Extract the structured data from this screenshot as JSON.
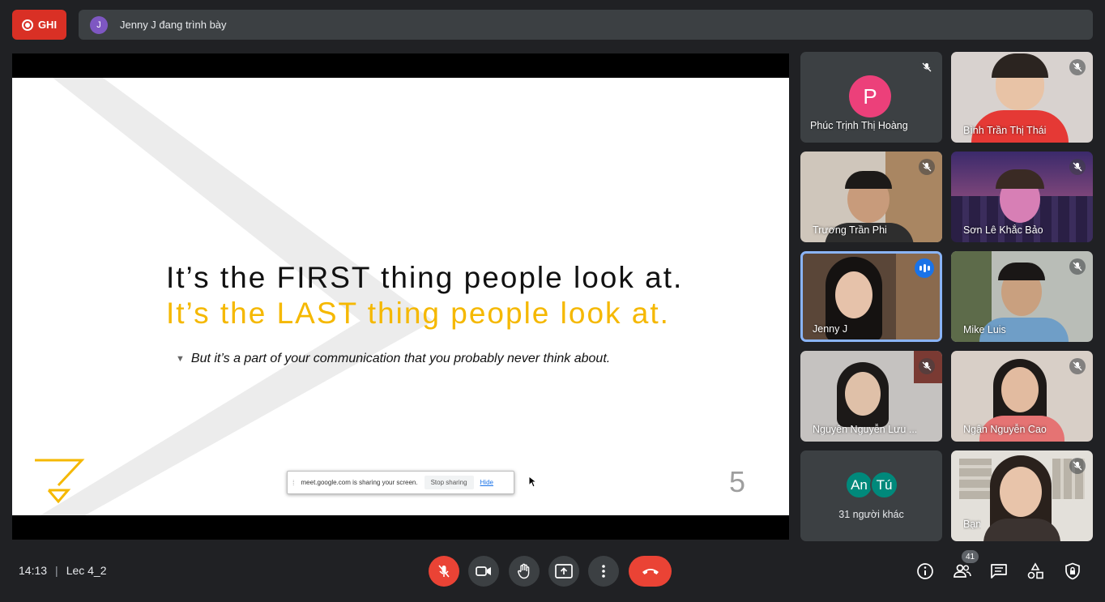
{
  "top": {
    "record_label": "GHI",
    "presenter_initial": "J",
    "presenter_text": "Jenny J đang trình bày"
  },
  "slide": {
    "line1": "It’s the FIRST thing people look at.",
    "line2": "It’s the LAST thing people look at.",
    "bullet": "But it’s a part of your communication that you probably never think about.",
    "page_number": "5",
    "accent_color": "#f5b800"
  },
  "share_bar": {
    "message": "meet.google.com is sharing your screen.",
    "stop_label": "Stop sharing",
    "hide_label": "Hide"
  },
  "participants": [
    {
      "name": "Phúc Trịnh Thị Hoàng",
      "initial": "P",
      "muted": true
    },
    {
      "name": "Bình Trần Thị Thái",
      "muted": true
    },
    {
      "name": "Trương Trần Phi",
      "muted": true
    },
    {
      "name": "Sơn Lê Khắc Bảo",
      "muted": true
    },
    {
      "name": "Jenny J",
      "speaking": true
    },
    {
      "name": "Mike Luis",
      "muted": true
    },
    {
      "name": "Nguyên Nguyễn Lưu ...",
      "muted": true
    },
    {
      "name": "Ngân Nguyễn Cao",
      "muted": true
    },
    {
      "others_initials": [
        "An",
        "Tú"
      ],
      "others_label": "31 người khác"
    },
    {
      "name": "Bạn",
      "muted": true
    }
  ],
  "bottom": {
    "time": "14:13",
    "meeting_name": "Lec 4_2",
    "people_count": "41"
  }
}
